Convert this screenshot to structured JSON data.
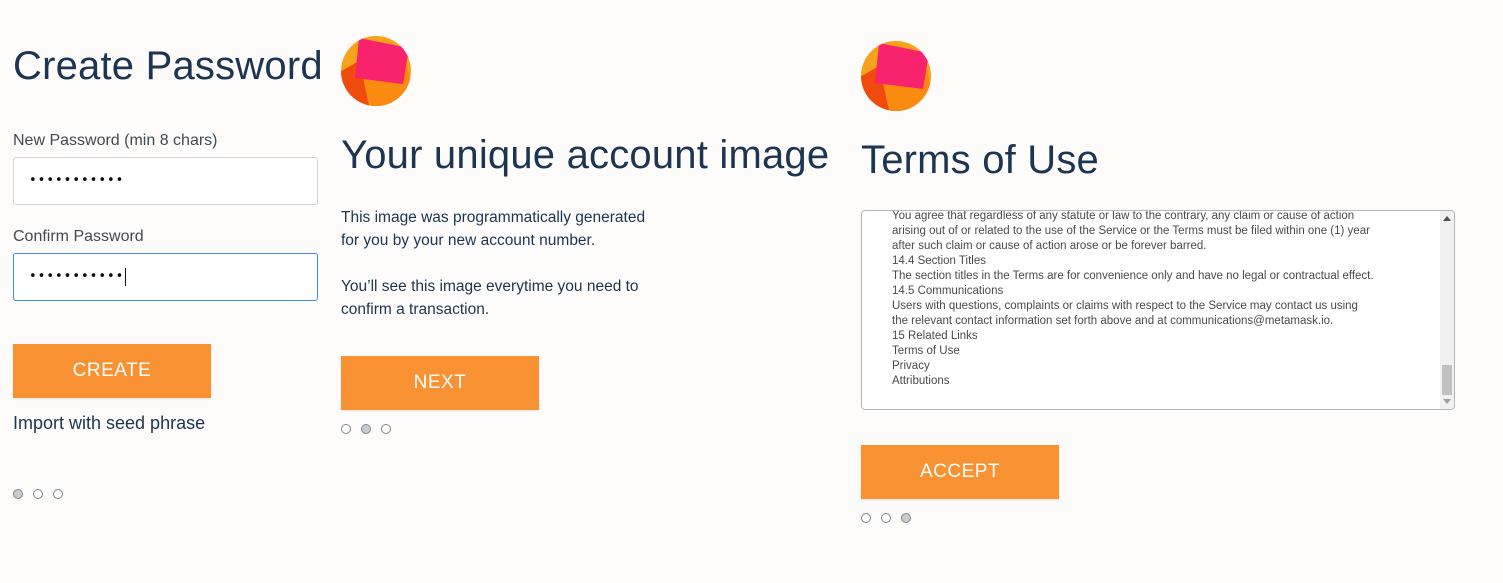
{
  "create_password": {
    "title": "Create Password",
    "new_password_label": "New Password (min 8 chars)",
    "new_password_value": "•••••••••••",
    "confirm_password_label": "Confirm Password",
    "confirm_password_value": "•••••••••••",
    "create_button": "CREATE",
    "import_link": "Import with seed phrase",
    "dots": {
      "count": 3,
      "active_index": 0
    }
  },
  "account_image": {
    "title": "Your unique account image",
    "paragraph1_line1": "This image was programmatically generated",
    "paragraph1_line2": "for you by your new account number.",
    "paragraph2_line1": "You’ll see this image everytime you need to",
    "paragraph2_line2": "confirm a transaction.",
    "next_button": "NEXT",
    "dots": {
      "count": 3,
      "active_index": 1
    }
  },
  "terms": {
    "title": "Terms of Use",
    "lines": [
      "You agree that regardless of any statute or law to the contrary, any claim or cause of action",
      "arising out of or related to the use of the Service or the Terms must be filed within one (1) year",
      "after such claim or cause of action arose or be forever barred.",
      "14.4 Section Titles",
      "The section titles in the Terms are for convenience only and have no legal or contractual effect.",
      "14.5 Communications",
      "Users with questions, complaints or claims with respect to the Service may contact us using",
      "the relevant contact information set forth above and at communications@metamask.io.",
      "15 Related Links",
      "Terms of Use",
      "Privacy",
      "Attributions"
    ],
    "accept_button": "ACCEPT",
    "dots": {
      "count": 3,
      "active_index": 2
    }
  },
  "colors": {
    "accent": "#f89232",
    "heading": "#1c3550",
    "focus_border": "#3f8ed8",
    "avatar_base": "#f7a21b",
    "avatar_pink": "#f8226d",
    "avatar_orange": "#fb8a10",
    "avatar_red": "#f04a0c"
  },
  "icons": {
    "account_avatar": "jazzicon-avatar"
  }
}
